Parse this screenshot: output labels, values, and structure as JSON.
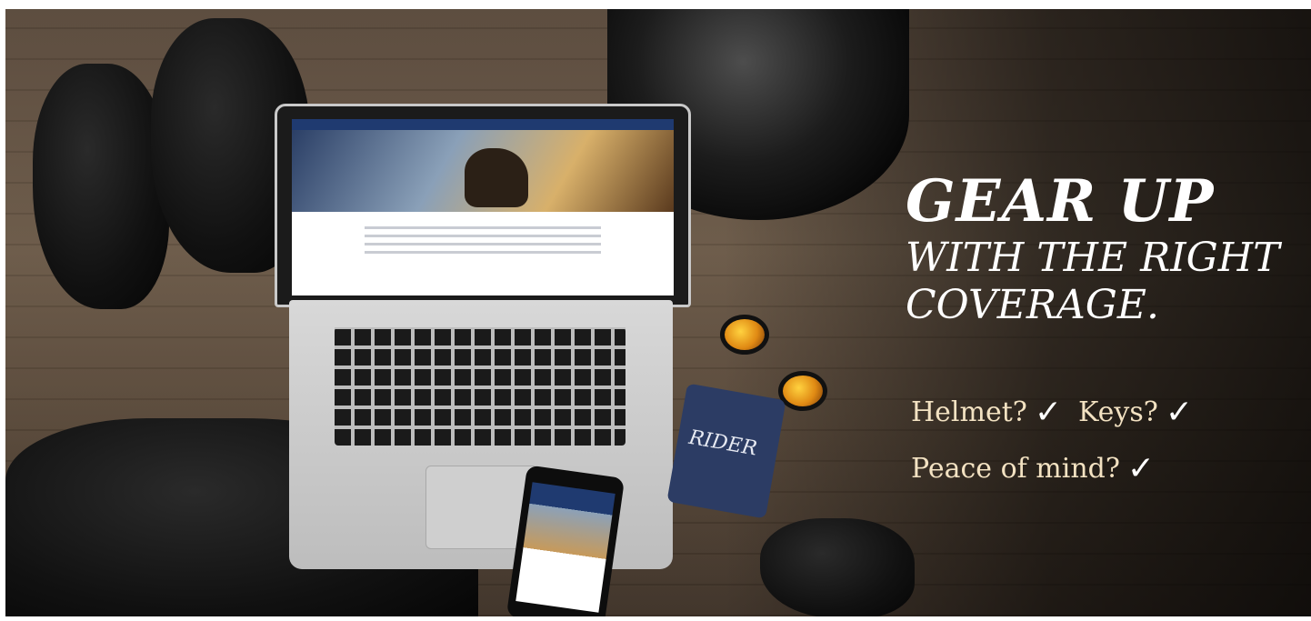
{
  "headline": {
    "line1": "GEAR UP",
    "line2": "WITH THE RIGHT",
    "line3": "COVERAGE."
  },
  "checklist": [
    {
      "label": "Helmet?",
      "mark": "✓"
    },
    {
      "label": "Keys?",
      "mark": "✓"
    },
    {
      "label": "Peace of mind?",
      "mark": "✓"
    }
  ],
  "card": {
    "brand": "RIDER"
  }
}
